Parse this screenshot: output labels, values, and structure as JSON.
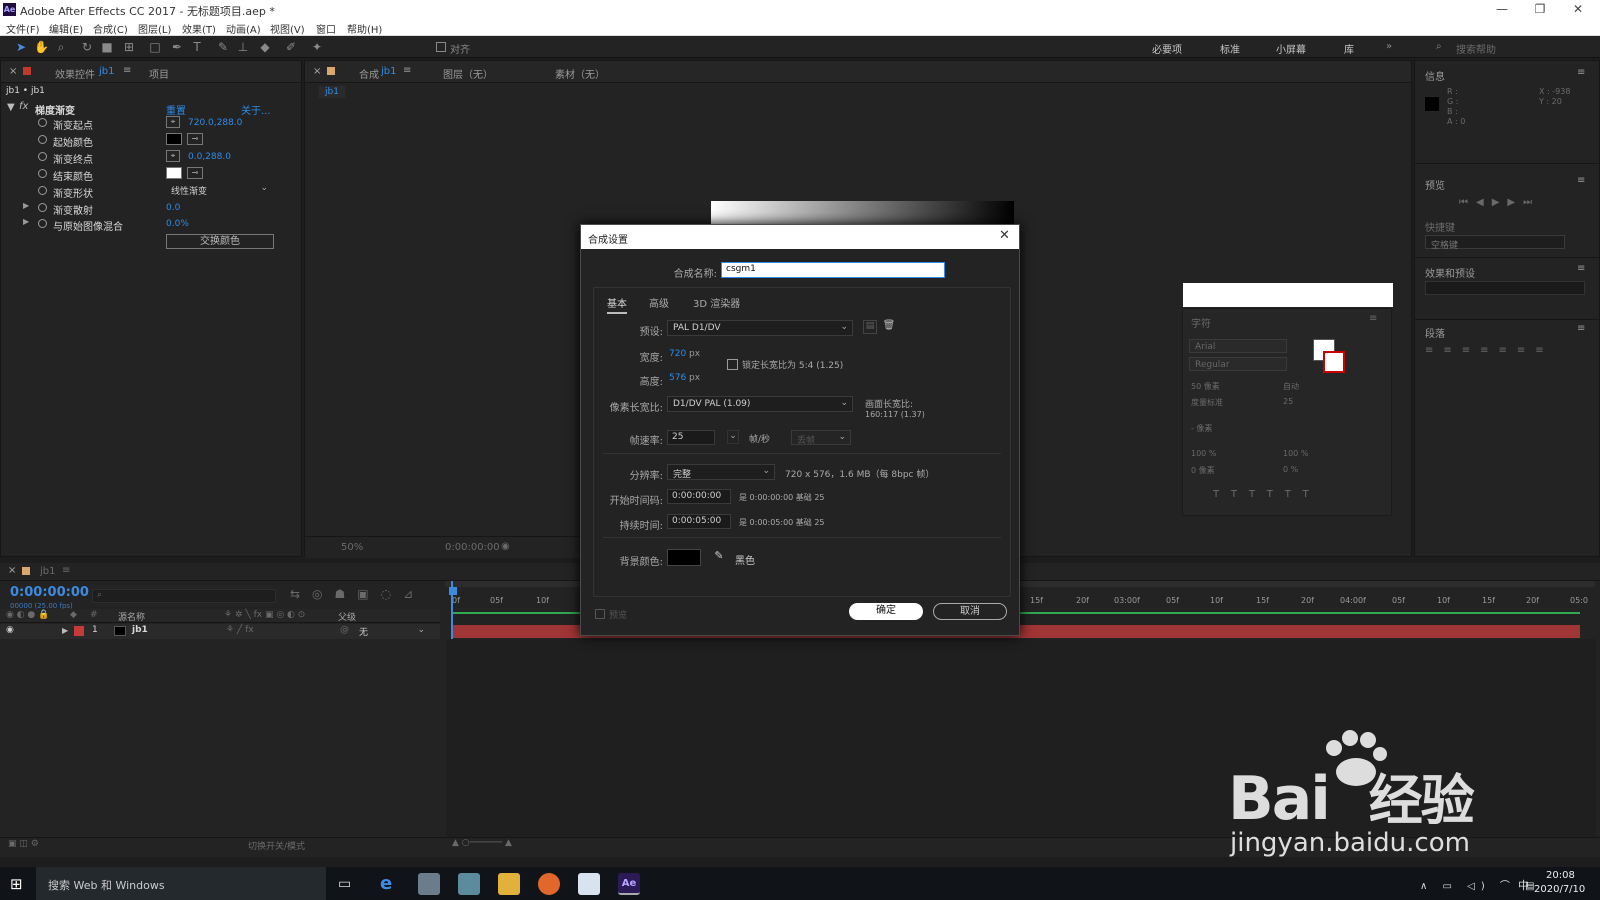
{
  "app": {
    "title": "Adobe After Effects CC 2017 - 无标题项目.aep *",
    "logo": "Ae"
  },
  "window_controls": {
    "minimize": "—",
    "restore": "❐",
    "close": "✕"
  },
  "menu": [
    "文件(F)",
    "编辑(E)",
    "合成(C)",
    "图层(L)",
    "效果(T)",
    "动画(A)",
    "视图(V)",
    "窗口",
    "帮助(H)"
  ],
  "toolbar": {
    "align_label": "对齐",
    "workspaces": [
      "必要项",
      "标准",
      "小屏幕",
      "库"
    ],
    "search_help": "搜索帮助"
  },
  "effect_controls": {
    "tab_label": "效果控件",
    "tab_target": "jb1",
    "tab_project": "项目",
    "breadcrumb": "jb1 • jb1",
    "effect_name": "梯度渐变",
    "reset": "重置",
    "about": "关于...",
    "props": [
      {
        "name": "渐变起点",
        "value": "720.0,288.0"
      },
      {
        "name": "起始颜色",
        "value": ""
      },
      {
        "name": "渐变终点",
        "value": "0.0,288.0"
      },
      {
        "name": "结束颜色",
        "value": ""
      },
      {
        "name": "渐变形状",
        "value": "线性渐变"
      },
      {
        "name": "渐变散射",
        "value": "0.0"
      },
      {
        "name": "与原始图像混合",
        "value": "0.0%"
      }
    ],
    "swap_button": "交换颜色",
    "colors": {
      "start": "#000000",
      "end": "#ffffff"
    }
  },
  "viewer": {
    "tab_comp": "合成",
    "tab_target": "jb1",
    "layer_tab": "图层（无）",
    "footage_tab": "素材（无）",
    "comp_chip": "jb1",
    "zoom": "50%",
    "timecode": "0:00:00:00"
  },
  "right_panels": {
    "info": {
      "title": "信息",
      "r": "R :",
      "g": "G :",
      "b": "B :",
      "a": "A : 0",
      "x": "X : -938",
      "y": "Y : 20"
    },
    "preview": {
      "title": "预览"
    },
    "shortcut": {
      "title": "快捷键",
      "value": "空格键"
    },
    "effects_presets": {
      "title": "效果和预设",
      "search_placeholder": ""
    },
    "character": {
      "title": "字符",
      "font": "Arial",
      "style": "Regular",
      "size": "50 像素",
      "leading": "自动",
      "kerning": "度量标准",
      "tracking": "25",
      "stroke": "- 像素",
      "vscale": "100 %",
      "hscale": "100 %",
      "baseline": "0 像素",
      "tsume": "0 %"
    },
    "paragraph": {
      "title": "段落"
    }
  },
  "dialog": {
    "title": "合成设置",
    "name_label": "合成名称:",
    "name_value": "csgm1",
    "tabs": [
      "基本",
      "高级",
      "3D 渲染器"
    ],
    "preset_label": "预设:",
    "preset_value": "PAL D1/DV",
    "width_label": "宽度:",
    "width_value": "720",
    "width_unit": "px",
    "height_label": "高度:",
    "height_value": "576",
    "height_unit": "px",
    "lock_label": "锁定长宽比为 5:4 (1.25)",
    "par_label": "像素长宽比:",
    "par_value": "D1/DV PAL (1.09)",
    "frame_aspect_label": "画面长宽比:",
    "frame_aspect_value": "160:117 (1.37)",
    "fps_label": "帧速率:",
    "fps_value": "25",
    "fps_unit": "帧/秒",
    "drop_frame": "丢帧",
    "res_label": "分辨率:",
    "res_value": "完整",
    "res_info": "720 x 576，1.6 MB（每 8bpc 帧）",
    "start_label": "开始时间码:",
    "start_value": "0:00:00:00",
    "start_info": "是 0:00:00:00  基础 25",
    "dur_label": "持续时间:",
    "dur_value": "0:00:05:00",
    "dur_info": "是 0:00:05:00  基础 25",
    "bg_label": "背景颜色:",
    "bg_name": "黑色",
    "bg_color": "#000000",
    "preview_label": "预览",
    "ok": "确定",
    "cancel": "取消"
  },
  "timeline": {
    "tab": "jb1",
    "timecode": "0:00:00:00",
    "frames": "00000 (25.00 fps)",
    "col_num": "#",
    "col_source": "源名称",
    "col_parent": "父级",
    "layer_num": "1",
    "layer_name": "jb1",
    "layer_parent": "无",
    "ruler_left": [
      "0f",
      "05f",
      "10f"
    ],
    "ruler_right": [
      "15f",
      "20f",
      "03:00f",
      "05f",
      "10f",
      "15f",
      "20f",
      "04:00f",
      "05f",
      "10f",
      "15f",
      "20f",
      "05:0"
    ],
    "footer": "切换开关/模式",
    "layer_color": "#c63a3a"
  },
  "taskbar": {
    "search": "搜索 Web 和 Windows",
    "time": "20:08",
    "date": "2020/7/10",
    "lang": "中"
  },
  "watermark": {
    "brand": "Bai",
    "brand_cn": "经验",
    "url": "jingyan.baidu.com"
  }
}
